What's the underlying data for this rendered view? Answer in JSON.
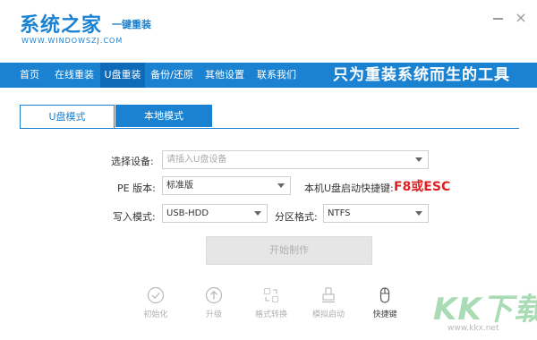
{
  "header": {
    "logo_main": "系统之家",
    "logo_tag": "一键重装",
    "logo_url": "WWW.WINDOWSZJ.COM",
    "minimize_icon": "minimize-icon",
    "close_icon": "close-icon",
    "close_glyph": "×"
  },
  "nav": {
    "items": [
      "首页",
      "在线重装",
      "U盘重装",
      "备份/还原",
      "其他设置",
      "联系我们"
    ],
    "active": "U盘重装",
    "slogan": "只为重装系统而生的工具",
    "color": "#1b82d2"
  },
  "tabs": {
    "usb_mode": "U盘模式",
    "local_mode": "本地模式",
    "active": "U盘模式"
  },
  "form": {
    "device_label": "选择设备:",
    "device_placeholder": "请插入U盘设备",
    "pe_label": "PE 版本:",
    "pe_value": "标准版",
    "hotkey_label": "本机U盘启动快捷键:",
    "hotkey_value": "F8或ESC",
    "write_label": "写入模式:",
    "write_value": "USB-HDD",
    "partition_label": "分区格式:",
    "partition_value": "NTFS"
  },
  "start_button": "开始制作",
  "steps": [
    {
      "label": "初始化",
      "icon": "check-circle-icon"
    },
    {
      "label": "升级",
      "icon": "upload-circle-icon"
    },
    {
      "label": "格式转换",
      "icon": "convert-icon"
    },
    {
      "label": "模拟启动",
      "icon": "usb-boot-icon"
    },
    {
      "label": "快捷键",
      "icon": "mouse-icon"
    }
  ],
  "watermark": {
    "text": "KK下载",
    "url": "www.kkx.net"
  }
}
